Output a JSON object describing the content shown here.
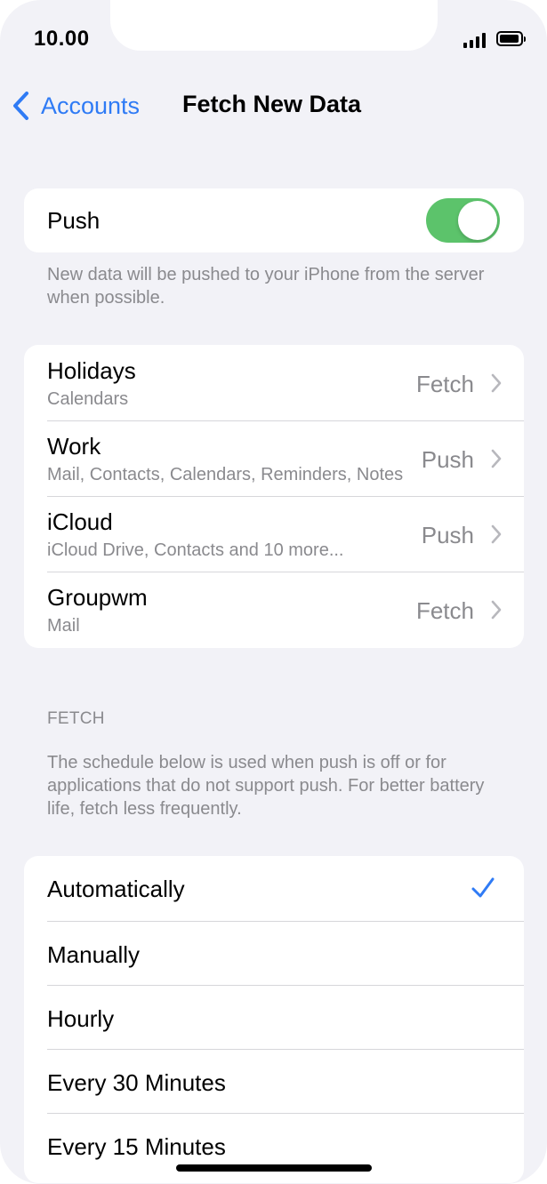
{
  "status_bar": {
    "time": "10.00"
  },
  "nav": {
    "back_label": "Accounts",
    "title": "Fetch New Data"
  },
  "push": {
    "label": "Push",
    "enabled": true,
    "note": "New data will be pushed to your iPhone from the server when possible."
  },
  "accounts": [
    {
      "name": "Holidays",
      "services": "Calendars",
      "mode": "Fetch"
    },
    {
      "name": "Work",
      "services": "Mail, Contacts, Calendars, Reminders, Notes",
      "mode": "Push"
    },
    {
      "name": "iCloud",
      "services": "iCloud Drive, Contacts and 10 more...",
      "mode": "Push"
    },
    {
      "name": "Groupwm",
      "services": "Mail",
      "mode": "Fetch"
    }
  ],
  "fetch": {
    "header": "FETCH",
    "note": "The schedule below is used when push is off or for applications that do not support push. For better battery life, fetch less frequently.",
    "options": [
      {
        "label": "Automatically",
        "selected": true
      },
      {
        "label": "Manually",
        "selected": false
      },
      {
        "label": "Hourly",
        "selected": false
      },
      {
        "label": "Every 30 Minutes",
        "selected": false
      },
      {
        "label": "Every 15 Minutes",
        "selected": false
      }
    ]
  },
  "colors": {
    "accent": "#2f7bf5",
    "toggle_on": "#5cc36b",
    "background": "#f2f2f7"
  }
}
